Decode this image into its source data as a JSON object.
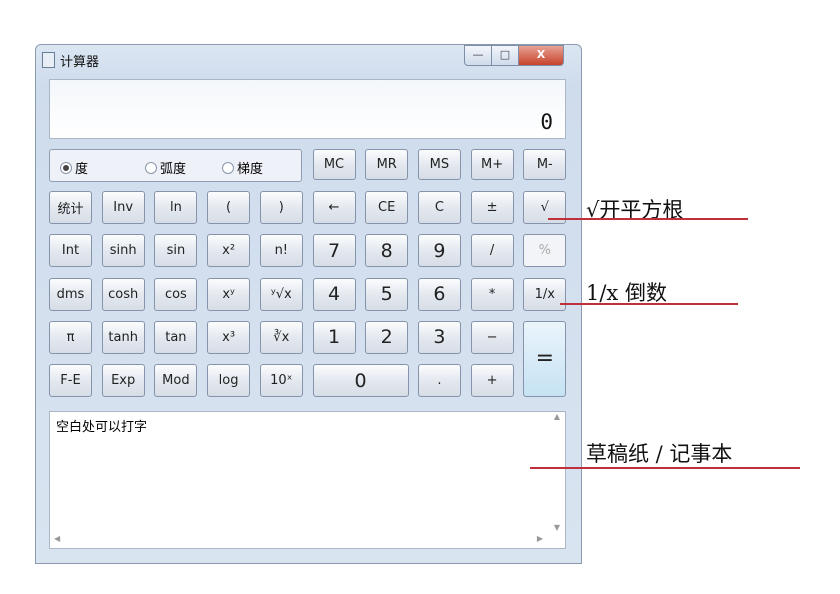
{
  "window": {
    "title": "计算器",
    "minimize": "—",
    "maximize": "□",
    "close": "X"
  },
  "display": {
    "value": "0"
  },
  "angle_modes": [
    {
      "label": "度",
      "selected": true
    },
    {
      "label": "弧度",
      "selected": false
    },
    {
      "label": "梯度",
      "selected": false
    }
  ],
  "memory": [
    "MC",
    "MR",
    "MS",
    "M+",
    "M-"
  ],
  "rows": [
    [
      "统计",
      "Inv",
      "ln",
      "(",
      ")",
      "←",
      "CE",
      "C",
      "±",
      "√"
    ],
    [
      "Int",
      "sinh",
      "sin",
      "x²",
      "n!",
      "7",
      "8",
      "9",
      "/",
      "%"
    ],
    [
      "dms",
      "cosh",
      "cos",
      "xʸ",
      "ʸ√x",
      "4",
      "5",
      "6",
      "*",
      "1/x"
    ],
    [
      "π",
      "tanh",
      "tan",
      "x³",
      "∛x",
      "1",
      "2",
      "3",
      "−",
      "="
    ],
    [
      "F-E",
      "Exp",
      "Mod",
      "log",
      "10ˣ",
      "0",
      ".",
      "+"
    ]
  ],
  "notepad": {
    "text": "空白处可以打字"
  },
  "annotations": [
    "√开平方根",
    "1/x 倒数",
    "草稿纸 / 记事本"
  ],
  "colors": {
    "annotation_line": "#c0303a",
    "equals_button": "#c6e2f3"
  }
}
